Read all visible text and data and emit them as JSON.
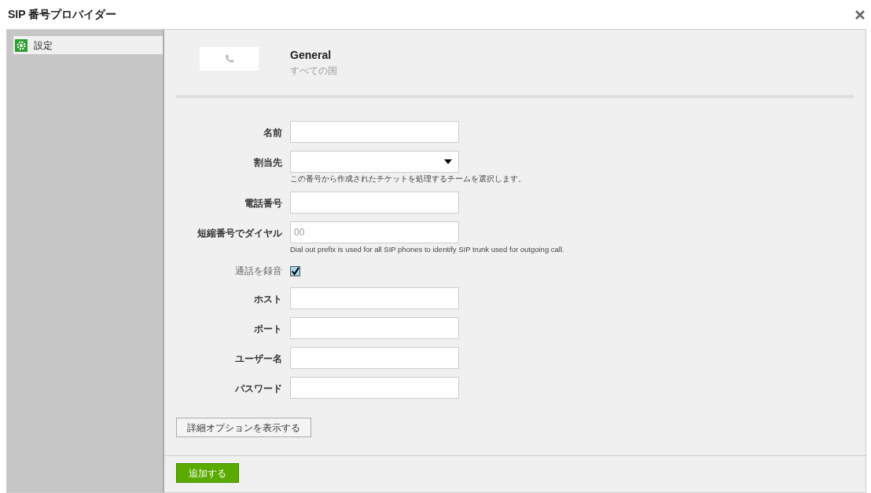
{
  "window": {
    "title": "SIP 番号プロバイダー"
  },
  "sidebar": {
    "items": [
      {
        "label": "設定",
        "selected": true
      }
    ]
  },
  "provider": {
    "name": "General",
    "region": "すべての国"
  },
  "fields": [
    {
      "kind": "text",
      "label": "名前"
    },
    {
      "kind": "select",
      "label": "割当先",
      "hint": "この番号から作成されたチケットを処理するチームを選択します。"
    },
    {
      "kind": "text",
      "label": "電話番号"
    },
    {
      "kind": "text",
      "label": "短縮番号でダイヤル",
      "placeholder": "00",
      "hint": "Dial out prefix is used for all SIP phones to identify SIP trunk used for outgoing call."
    },
    {
      "kind": "checkbox",
      "label": "通話を録音",
      "checked": true
    },
    {
      "kind": "text",
      "label": "ホスト"
    },
    {
      "kind": "text",
      "label": "ポート"
    },
    {
      "kind": "text",
      "label": "ユーザー名"
    },
    {
      "kind": "text",
      "label": "パスワード"
    }
  ],
  "advanced_button": "詳細オプションを表示する",
  "submit_button": "追加する"
}
